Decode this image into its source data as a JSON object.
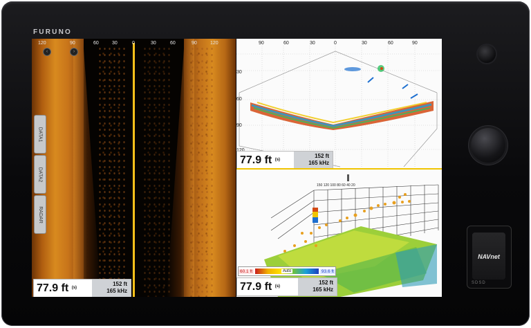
{
  "device": {
    "brand": "FURUNO"
  },
  "sidescan": {
    "range_ticks": [
      "120",
      "90",
      "60",
      "30",
      "0",
      "30",
      "60",
      "90",
      "120"
    ],
    "side_tabs": [
      "DATA1",
      "DATA2",
      "RADAR"
    ],
    "readout": {
      "depth": "77.9 ft",
      "depth_marker": "(s)",
      "range": "152 ft",
      "frequency": "165 kHz"
    }
  },
  "down_view": {
    "angle_ticks": [
      "90",
      "60",
      "30",
      "0",
      "30",
      "60",
      "90"
    ],
    "depth_ticks": [
      "30",
      "60",
      "90",
      "120"
    ],
    "readout": {
      "depth": "77.9 ft",
      "depth_marker": "(s)",
      "range": "152 ft",
      "frequency": "165 kHz"
    }
  },
  "view_3d": {
    "scale_ticks": "150 120 100 80 60 40 20",
    "color_bar": {
      "min": "60.1 ft",
      "mode": "Auto",
      "max": "93.6 ft"
    },
    "readout": {
      "depth": "77.9 ft",
      "depth_marker": "(s)",
      "range": "152 ft",
      "frequency": "165 kHz"
    }
  },
  "hardware": {
    "card_logo": "NAVnet",
    "card_base": "SDSD"
  },
  "colors": {
    "centerline": "#ffc21a",
    "sonar_amber": "#d88a1f",
    "divider": "#f0c400"
  }
}
